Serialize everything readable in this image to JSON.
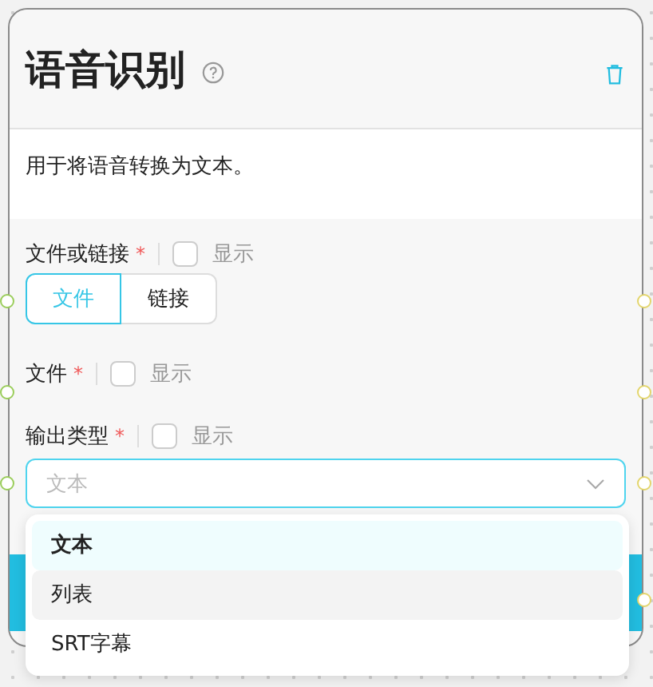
{
  "node": {
    "title": "语音识别",
    "description": "用于将语音转换为文本。"
  },
  "fields": [
    {
      "kind": "segmented",
      "label": "文件或链接",
      "required_mark": "*",
      "show_label": "显示",
      "show_checked": false,
      "options": [
        {
          "label": "文件",
          "selected": true
        },
        {
          "label": "链接",
          "selected": false
        }
      ]
    },
    {
      "kind": "plain",
      "label": "文件",
      "required_mark": "*",
      "show_label": "显示",
      "show_checked": false
    },
    {
      "kind": "select",
      "label": "输出类型",
      "required_mark": "*",
      "show_label": "显示",
      "show_checked": false,
      "placeholder": "文本",
      "expanded": true
    }
  ],
  "dropdown": [
    {
      "label": "文本",
      "selected": true,
      "hovered": false
    },
    {
      "label": "列表",
      "selected": false,
      "hovered": true
    },
    {
      "label": "SRT字幕",
      "selected": false,
      "hovered": false
    }
  ]
}
